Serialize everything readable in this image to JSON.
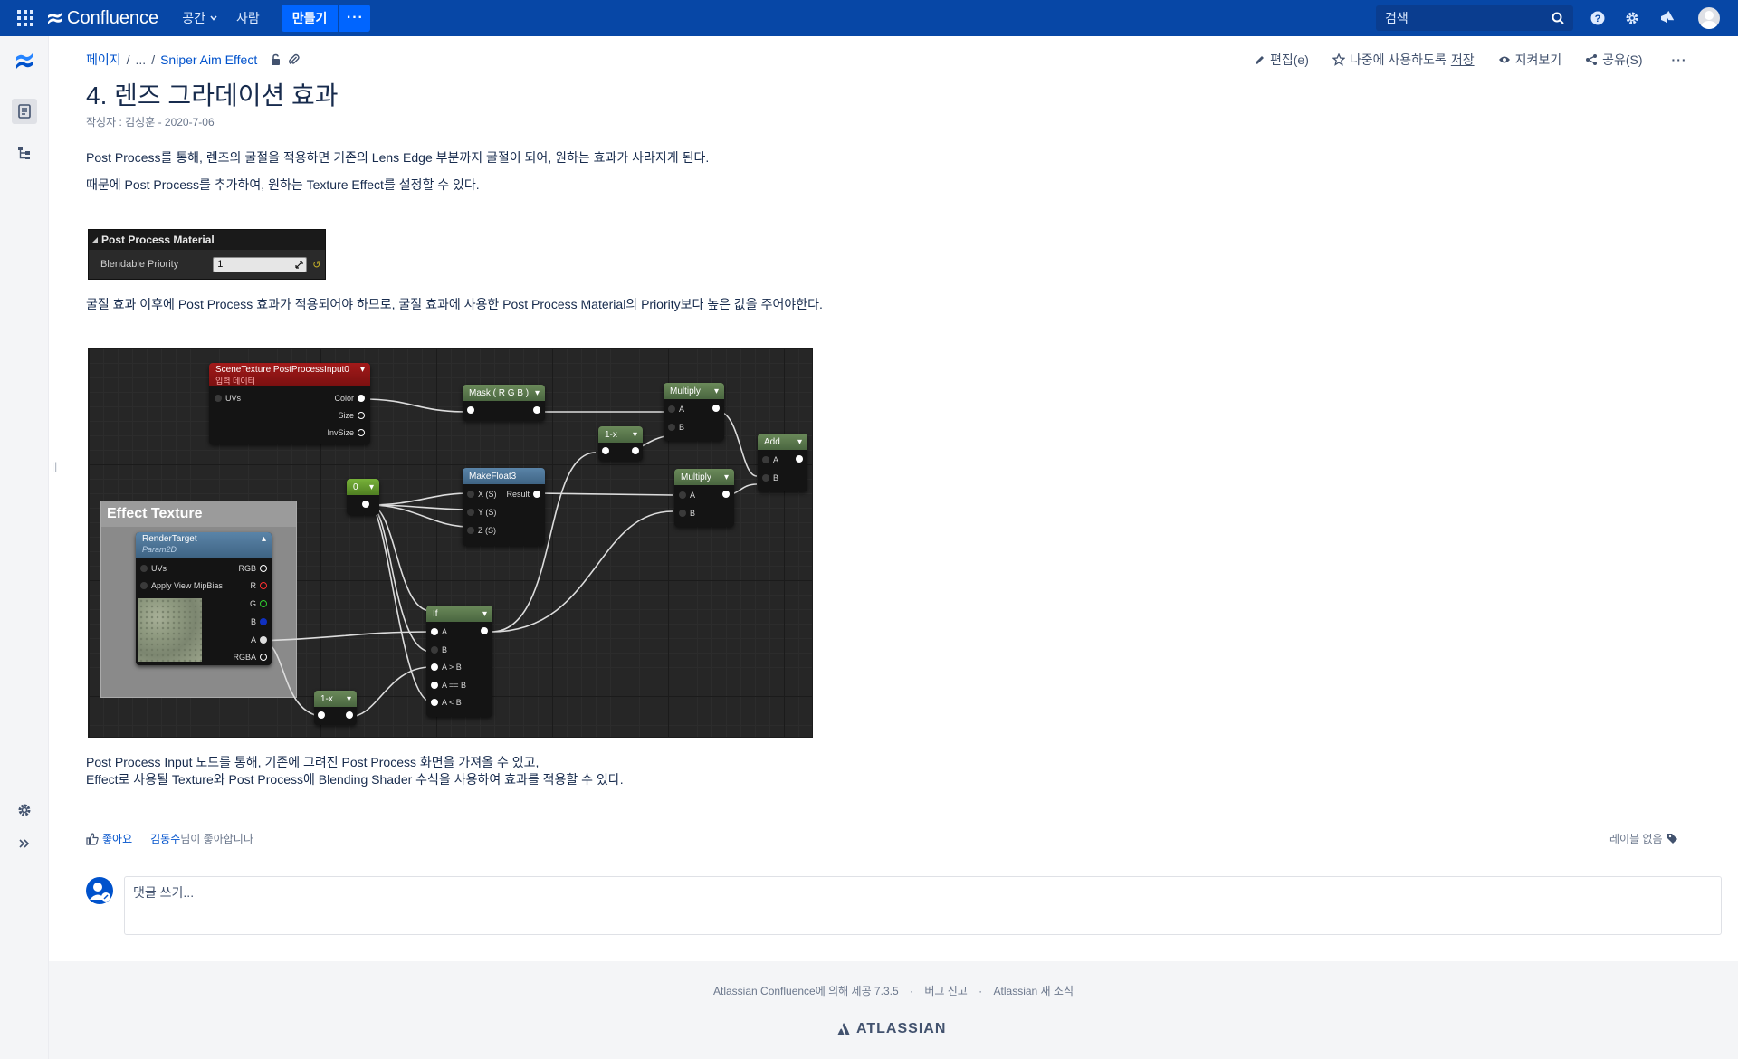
{
  "nav": {
    "product": "Confluence",
    "spaces": "공간",
    "people": "사람",
    "create": "만들기",
    "more": "···",
    "search_placeholder": "검색"
  },
  "breadcrumb": {
    "root": "페이지",
    "sep1": "/",
    "ellipsis": "...",
    "sep2": "/",
    "parent": "Sniper Aim Effect"
  },
  "actions": {
    "edit": "편집(e)",
    "save_later_prefix": "나중에 사용하도록",
    "save_later": "저장",
    "watch": "지켜보기",
    "share": "공유(S)",
    "more": "···"
  },
  "page": {
    "title": "4. 렌즈 그라데이션 효과",
    "byline": "작성자 : 김성훈 - 2020-7-06",
    "para1": "Post Process를 통해, 렌즈의 굴절을 적용하면 기존의 Lens Edge 부분까지 굴절이 되어, 원하는 효과가 사라지게 된다.",
    "para2": "때문에 Post Process를 추가하여, 원하는 Texture Effect를 설정할 수 있다.",
    "para3": "굴절 효과 이후에 Post Process 효과가 적용되어야 하므로, 굴절 효과에 사용한 Post Process Material의 Priority보다 높은 값을 주어야한다.",
    "para4": "Post Process Input 노드를 통해, 기존에 그려진 Post Process 화면을 가져올 수 있고,",
    "para5": "Effect로 사용될 Texture와 Post Process에 Blending Shader 수식을 사용하여 효과를 적용할 수 있다."
  },
  "ppm_panel": {
    "header": "Post Process Material",
    "label": "Blendable Priority",
    "value": "1"
  },
  "graph": {
    "scene_texture": {
      "title": "SceneTexture:PostProcessInput0",
      "subtitle": "입력 데이터",
      "uvs": "UVs",
      "color": "Color",
      "size": "Size",
      "invsize": "InvSize"
    },
    "mask": {
      "title": "Mask ( R G B )"
    },
    "multiply1": {
      "title": "Multiply",
      "a": "A",
      "b": "B"
    },
    "one_minus1": {
      "title": "1-x"
    },
    "add": {
      "title": "Add",
      "a": "A",
      "b": "B"
    },
    "const0": {
      "title": "0"
    },
    "makefloat3": {
      "title": "MakeFloat3",
      "x": "X (S)",
      "result": "Result",
      "y": "Y (S)",
      "z": "Z (S)"
    },
    "multiply2": {
      "title": "Multiply",
      "a": "A",
      "b": "B"
    },
    "comment": {
      "title": "Effect Texture"
    },
    "render_target": {
      "title": "RenderTarget",
      "subtitle": "Param2D",
      "uvs": "UVs",
      "mip": "Apply View MipBias",
      "rgb": "RGB",
      "r": "R",
      "g": "G",
      "b": "B",
      "a": "A",
      "rgba": "RGBA"
    },
    "if_node": {
      "title": "If",
      "a": "A",
      "b": "B",
      "agb": "A > B",
      "aeb": "A == B",
      "alb": "A < B"
    },
    "one_minus2": {
      "title": "1-x"
    }
  },
  "meta": {
    "like": "좋아요",
    "liked_by_name": "김동수",
    "liked_by_suffix": "님이 좋아합니다",
    "no_labels": "레이블 없음",
    "comment_placeholder": "댓글 쓰기..."
  },
  "footer": {
    "powered": "Atlassian Confluence에 의해 제공 7.3.5",
    "sep": "·",
    "bug": "버그 신고",
    "news": "Atlassian 새 소식",
    "brand": "ATLASSIAN"
  },
  "colors": {
    "nav_bg": "#0747a6",
    "create_btn": "#0065ff",
    "link": "#0052cc"
  }
}
